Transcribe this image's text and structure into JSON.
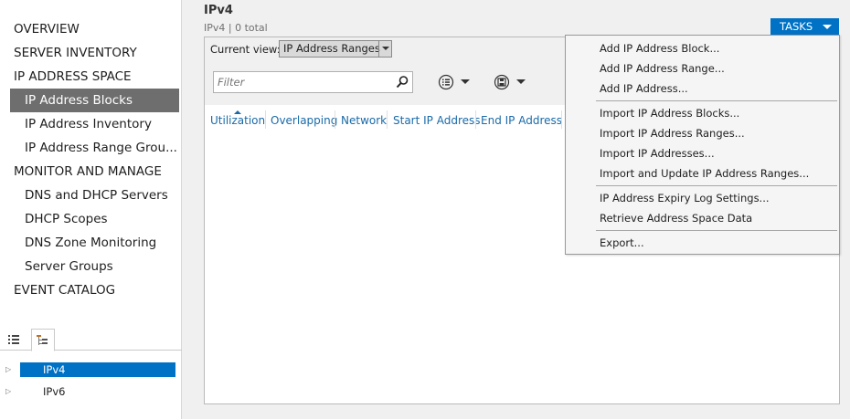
{
  "nav": {
    "items": [
      {
        "label": "OVERVIEW"
      },
      {
        "label": "SERVER INVENTORY"
      },
      {
        "label": "IP ADDRESS SPACE"
      },
      {
        "label": "IP Address Blocks"
      },
      {
        "label": "IP Address Inventory"
      },
      {
        "label": "IP Address Range Grou..."
      },
      {
        "label": "MONITOR AND MANAGE"
      },
      {
        "label": "DNS and DHCP Servers"
      },
      {
        "label": "DHCP Scopes"
      },
      {
        "label": "DNS Zone Monitoring"
      },
      {
        "label": "Server Groups"
      },
      {
        "label": "EVENT CATALOG"
      }
    ],
    "selected": "IP Address Blocks",
    "tree": [
      {
        "label": "IPv4",
        "selected": true
      },
      {
        "label": "IPv6",
        "selected": false
      }
    ]
  },
  "main": {
    "title": "IPv4",
    "subtitle": "IPv4 | 0 total",
    "tasks_label": "TASKS",
    "current_view_label": "Current view:",
    "current_view_value": "IP Address Ranges",
    "filter_placeholder": "Filter",
    "columns": [
      "Utilization",
      "Overlapping",
      "Network",
      "Start IP Address",
      "End IP Address"
    ]
  },
  "tasks_menu": {
    "groups": [
      [
        "Add IP Address Block...",
        "Add IP Address Range...",
        "Add IP Address..."
      ],
      [
        "Import IP Address Blocks...",
        "Import IP Address Ranges...",
        "Import IP Addresses...",
        "Import and Update IP Address Ranges..."
      ],
      [
        "IP Address Expiry Log Settings...",
        "Retrieve Address Space Data"
      ],
      [
        "Export..."
      ]
    ]
  },
  "colors": {
    "accent": "#0072c6",
    "nav_selected": "#6e6e6e",
    "link": "#1a6aa8"
  }
}
